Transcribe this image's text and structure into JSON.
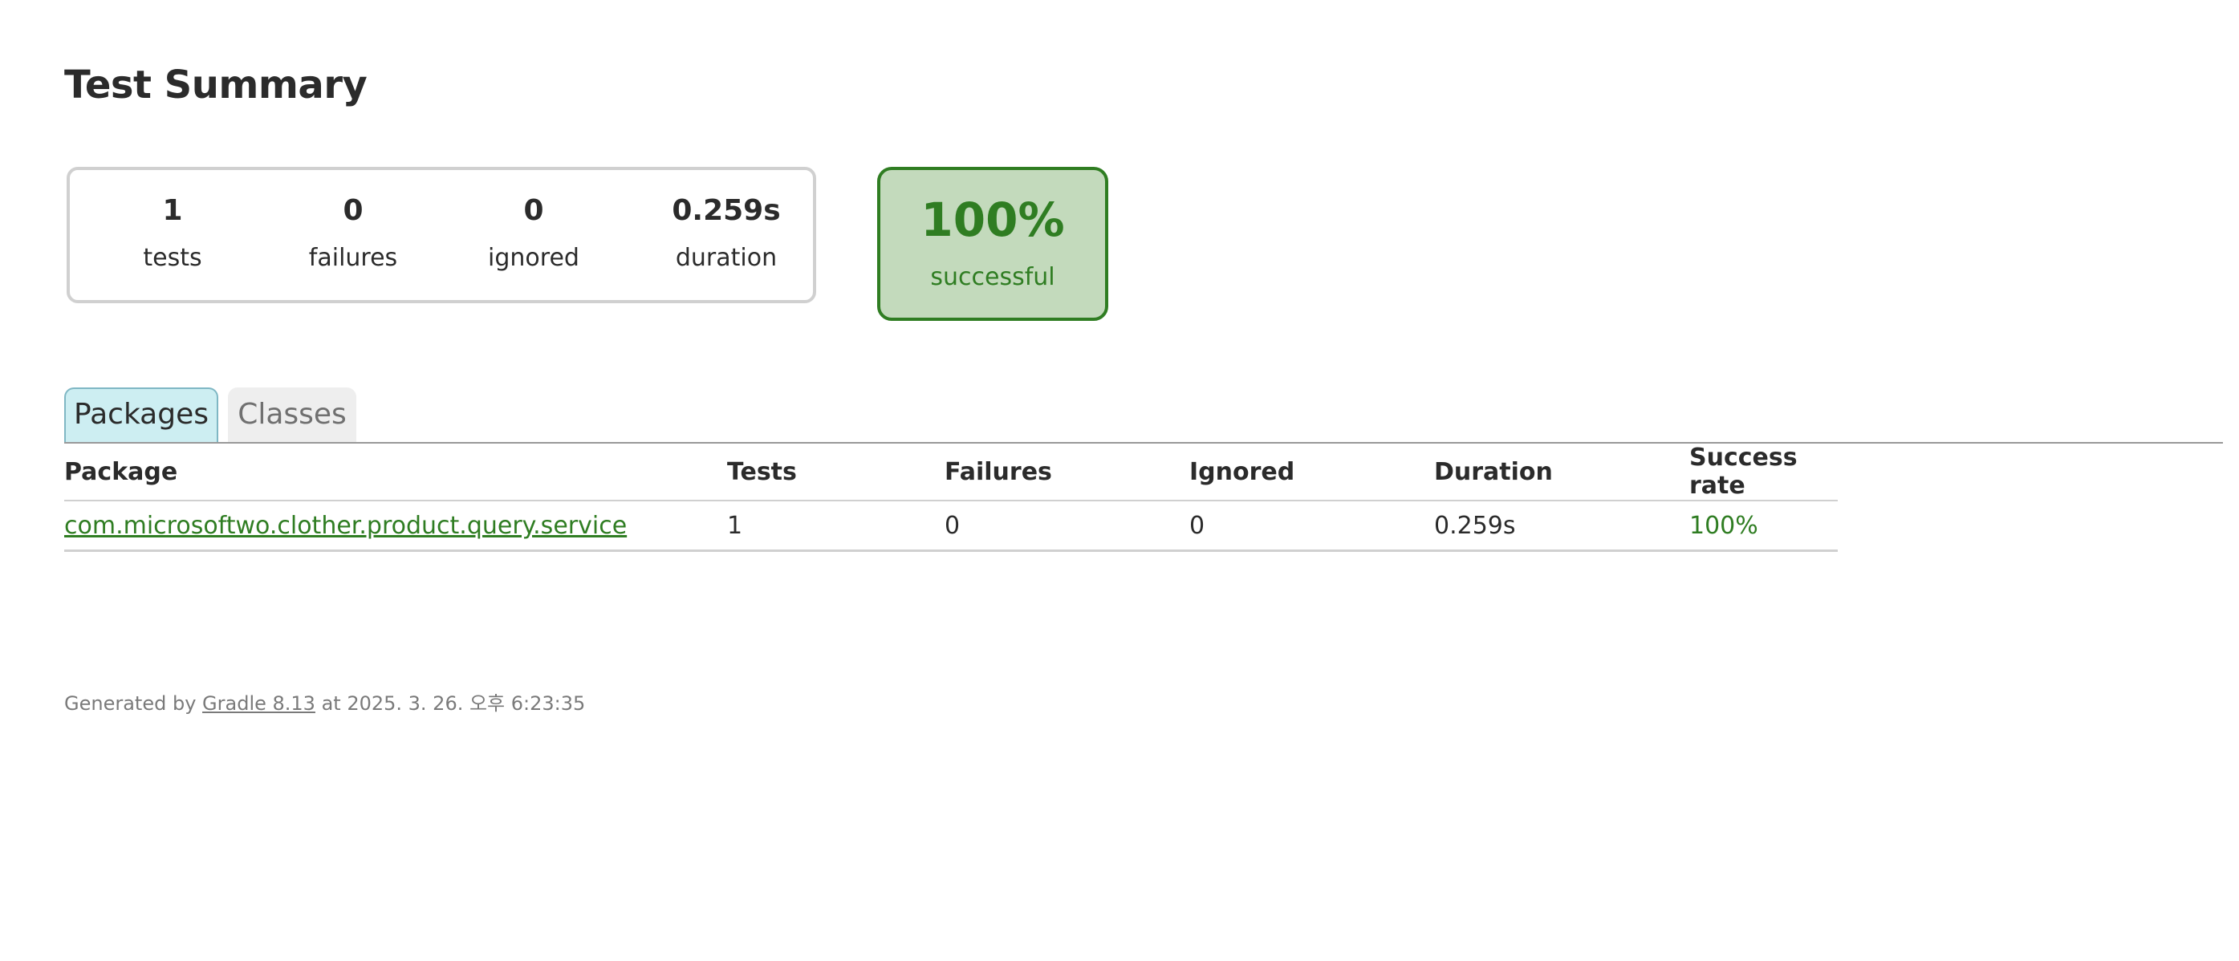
{
  "page": {
    "title": "Test Summary"
  },
  "summary": {
    "counters": [
      {
        "value": "1",
        "label": "tests"
      },
      {
        "value": "0",
        "label": "failures"
      },
      {
        "value": "0",
        "label": "ignored"
      },
      {
        "value": "0.259s",
        "label": "duration"
      }
    ],
    "success": {
      "percent": "100%",
      "label": "successful",
      "fill_color": "#c3dabc",
      "border_color": "#2f7d22"
    }
  },
  "tabs": [
    {
      "label": "Packages",
      "selected": true
    },
    {
      "label": "Classes",
      "selected": false
    }
  ],
  "table": {
    "headers": [
      "Package",
      "Tests",
      "Failures",
      "Ignored",
      "Duration",
      "Success rate"
    ],
    "rows": [
      {
        "package": "com.microsoftwo.clother.product.query.service",
        "tests": "1",
        "failures": "0",
        "ignored": "0",
        "duration": "0.259s",
        "success_rate": "100%"
      }
    ]
  },
  "footer": {
    "prefix": "Generated by ",
    "link": "Gradle 8.13",
    "suffix": " at 2025. 3. 26. 오후 6:23:35"
  },
  "colors": {
    "success": "#2f7d22",
    "selected_tab": "#cdeef2",
    "unselected_tab": "#eeeeee"
  }
}
